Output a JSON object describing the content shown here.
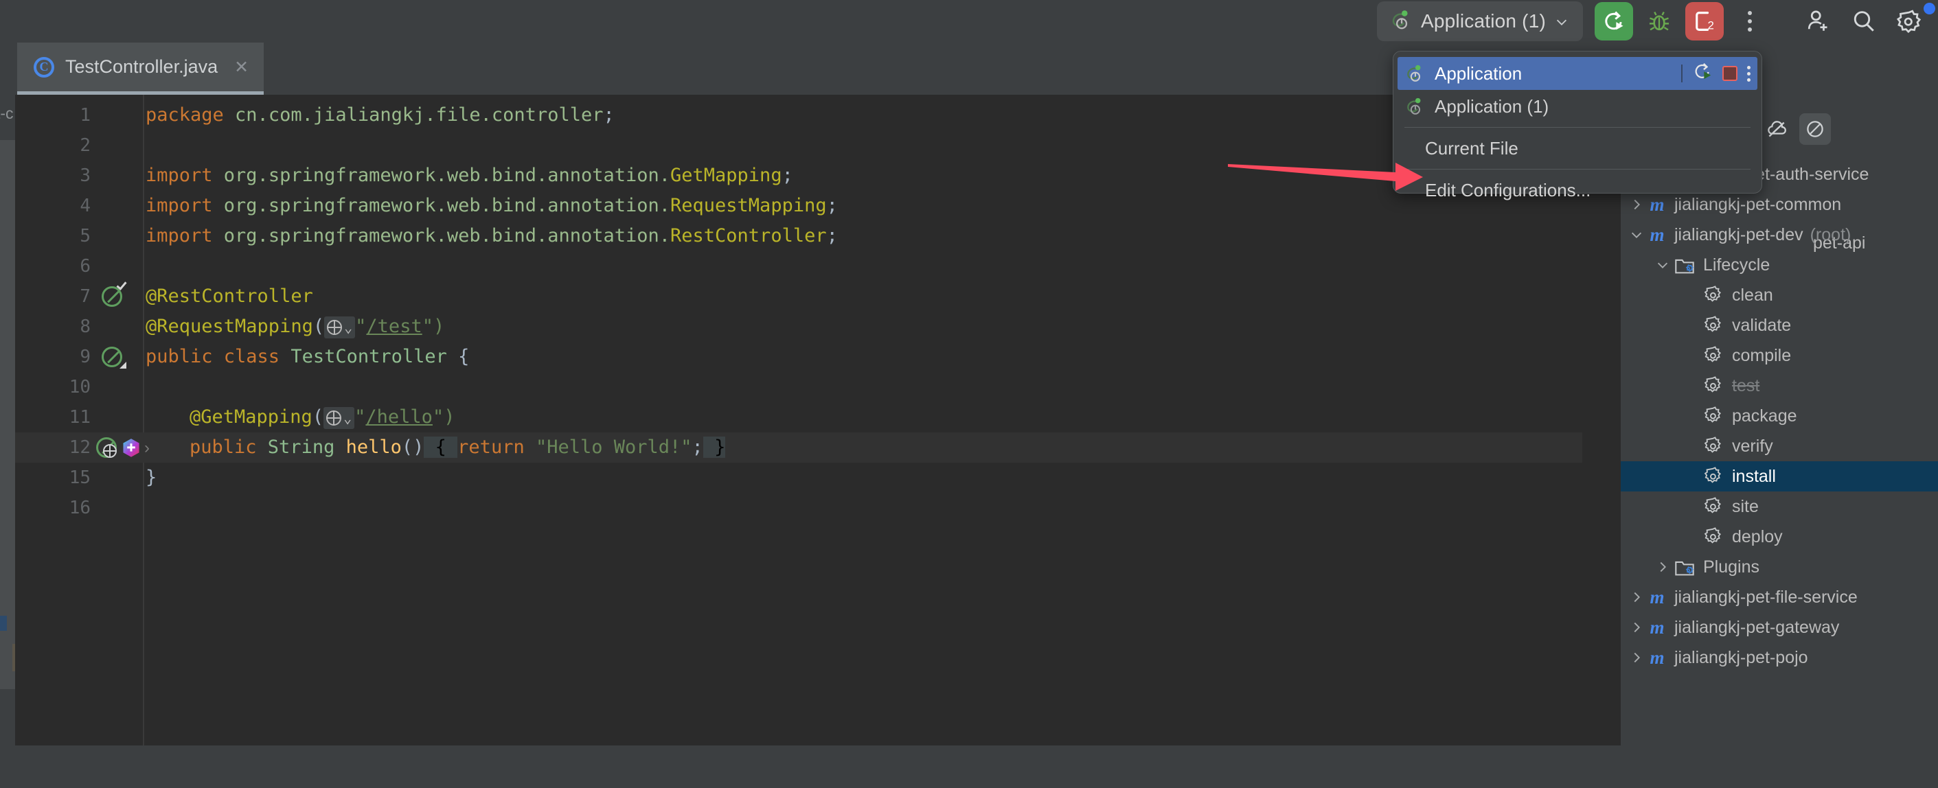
{
  "toolbar": {
    "run_config_name": "Application (1)",
    "chevron_icon": "chevron-down-icon",
    "run_icon": "run-with-coverage-icon",
    "debug_icon": "debug-bug-icon",
    "stop_icon": "stop-process-icon",
    "stop_badge": "2",
    "more_icon": "more-vertical-icon",
    "invite_icon": "add-user-icon",
    "search_icon": "search-icon",
    "settings_icon": "gear-icon",
    "accent_green": "#4a9e53",
    "accent_red": "#c75450",
    "badge_blue": "#3574f0"
  },
  "editor_tab": {
    "icon": "java-class-icon",
    "title": "TestController.java",
    "close_icon": "close-icon"
  },
  "code": {
    "language": "java",
    "lines": [
      {
        "num": "1",
        "indent": 0,
        "tokens": [
          {
            "t": "package ",
            "c": "kw"
          },
          {
            "t": "cn.com.jialiangkj.file.controller",
            "c": "pkg"
          },
          {
            "t": ";",
            "c": "pn"
          }
        ]
      },
      {
        "num": "2",
        "indent": 0,
        "tokens": []
      },
      {
        "num": "3",
        "indent": 0,
        "tokens": [
          {
            "t": "import ",
            "c": "kw"
          },
          {
            "t": "org.springframework.web.bind.annotation.",
            "c": "pkg"
          },
          {
            "t": "GetMapping",
            "c": "ann"
          },
          {
            "t": ";",
            "c": "pn"
          }
        ]
      },
      {
        "num": "4",
        "indent": 0,
        "tokens": [
          {
            "t": "import ",
            "c": "kw"
          },
          {
            "t": "org.springframework.web.bind.annotation.",
            "c": "pkg"
          },
          {
            "t": "RequestMapping",
            "c": "ann"
          },
          {
            "t": ";",
            "c": "pn"
          }
        ]
      },
      {
        "num": "5",
        "indent": 0,
        "tokens": [
          {
            "t": "import ",
            "c": "kw"
          },
          {
            "t": "org.springframework.web.bind.annotation.",
            "c": "pkg"
          },
          {
            "t": "RestController",
            "c": "ann"
          },
          {
            "t": ";",
            "c": "pn"
          }
        ]
      },
      {
        "num": "6",
        "indent": 0,
        "tokens": []
      },
      {
        "num": "7",
        "indent": 0,
        "tokens": [
          {
            "t": "@RestController",
            "c": "ann"
          }
        ]
      },
      {
        "num": "8",
        "indent": 0,
        "tokens": [
          {
            "t": "@RequestMapping",
            "c": "ann"
          },
          {
            "t": "(",
            "c": "pn"
          },
          {
            "t": "__GLOBE__",
            "c": "globe"
          },
          {
            "t": "\"",
            "c": "str"
          },
          {
            "t": "/test",
            "c": "urlstr"
          },
          {
            "t": "\")",
            "c": "str"
          }
        ]
      },
      {
        "num": "9",
        "indent": 0,
        "tokens": [
          {
            "t": "public class ",
            "c": "kw"
          },
          {
            "t": "TestController",
            "c": "typ"
          },
          {
            "t": " {",
            "c": "brace"
          }
        ]
      },
      {
        "num": "10",
        "indent": 0,
        "tokens": []
      },
      {
        "num": "11",
        "indent": 1,
        "tokens": [
          {
            "t": "@GetMapping",
            "c": "ann"
          },
          {
            "t": "(",
            "c": "pn"
          },
          {
            "t": "__GLOBE__",
            "c": "globe"
          },
          {
            "t": "\"",
            "c": "str"
          },
          {
            "t": "/hello",
            "c": "urlstr"
          },
          {
            "t": "\")",
            "c": "str"
          }
        ]
      },
      {
        "num": "12",
        "indent": 1,
        "highlight": true,
        "tokens": [
          {
            "t": "public ",
            "c": "kw"
          },
          {
            "t": "String ",
            "c": "typ"
          },
          {
            "t": "hello",
            "c": "mth"
          },
          {
            "t": "()",
            "c": "pn"
          },
          {
            "t": " { ",
            "c": "brace-hl"
          },
          {
            "t": "return ",
            "c": "kw"
          },
          {
            "t": "\"Hello World!\"",
            "c": "str"
          },
          {
            "t": ";",
            "c": "pn"
          },
          {
            "t": " }",
            "c": "brace-hl"
          }
        ]
      },
      {
        "num": "15",
        "indent": 0,
        "tokens": [
          {
            "t": "}",
            "c": "brace"
          }
        ]
      },
      {
        "num": "16",
        "indent": 0,
        "tokens": []
      }
    ],
    "gutter_icons": {
      "line7": "run-class-gutter-icon",
      "line9": "run-class-gutter-icon",
      "line11": "",
      "line12": "run-method-gutter-icon"
    }
  },
  "popup": {
    "items": [
      {
        "label": "Application",
        "icon": "spring-boot-run-icon",
        "selected": true,
        "actions": [
          "rerun-icon",
          "stop-icon",
          "more-vertical-icon"
        ]
      },
      {
        "label": "Application (1)",
        "icon": "spring-boot-run-icon",
        "selected": false
      }
    ],
    "current_file": "Current File",
    "edit_configurations": "Edit Configurations..."
  },
  "annotation": {
    "arrow_color": "#fb4a5e",
    "points_to": "Edit Configurations..."
  },
  "maven_panel": {
    "toolbar_icons": [
      "add-icon",
      "run-maven-build-icon",
      "execute-maven-goal-icon",
      "toggle-offline-icon",
      "skip-tests-icon"
    ],
    "hidden_row_label": "pet-api",
    "tree": [
      {
        "label": "jialiangkj-pet-auth-service",
        "indent": 1,
        "chevron": "right",
        "icon": "maven-module-icon"
      },
      {
        "label": "jialiangkj-pet-common",
        "indent": 1,
        "chevron": "right",
        "icon": "maven-module-icon"
      },
      {
        "label": "jialiangkj-pet-dev",
        "indent": 1,
        "chevron": "down",
        "icon": "maven-module-icon",
        "suffix": "(root)"
      },
      {
        "label": "Lifecycle",
        "indent": 2,
        "chevron": "down",
        "icon": "lifecycle-folder-icon"
      },
      {
        "label": "clean",
        "indent": 3,
        "chevron": "none",
        "icon": "maven-goal-icon"
      },
      {
        "label": "validate",
        "indent": 3,
        "chevron": "none",
        "icon": "maven-goal-icon"
      },
      {
        "label": "compile",
        "indent": 3,
        "chevron": "none",
        "icon": "maven-goal-icon"
      },
      {
        "label": "test",
        "indent": 3,
        "chevron": "none",
        "icon": "maven-goal-icon",
        "strikethrough": true
      },
      {
        "label": "package",
        "indent": 3,
        "chevron": "none",
        "icon": "maven-goal-icon"
      },
      {
        "label": "verify",
        "indent": 3,
        "chevron": "none",
        "icon": "maven-goal-icon"
      },
      {
        "label": "install",
        "indent": 3,
        "chevron": "none",
        "icon": "maven-goal-icon",
        "selected": true
      },
      {
        "label": "site",
        "indent": 3,
        "chevron": "none",
        "icon": "maven-goal-icon"
      },
      {
        "label": "deploy",
        "indent": 3,
        "chevron": "none",
        "icon": "maven-goal-icon"
      },
      {
        "label": "Plugins",
        "indent": 2,
        "chevron": "right",
        "icon": "plugins-folder-icon"
      },
      {
        "label": "jialiangkj-pet-file-service",
        "indent": 1,
        "chevron": "right",
        "icon": "maven-module-icon"
      },
      {
        "label": "jialiangkj-pet-gateway",
        "indent": 1,
        "chevron": "right",
        "icon": "maven-module-icon"
      },
      {
        "label": "jialiangkj-pet-pojo",
        "indent": 1,
        "chevron": "right",
        "icon": "maven-module-icon"
      }
    ],
    "selection_color": "#0d3a58"
  },
  "left_panel": {
    "ghost_label": "t-c"
  }
}
